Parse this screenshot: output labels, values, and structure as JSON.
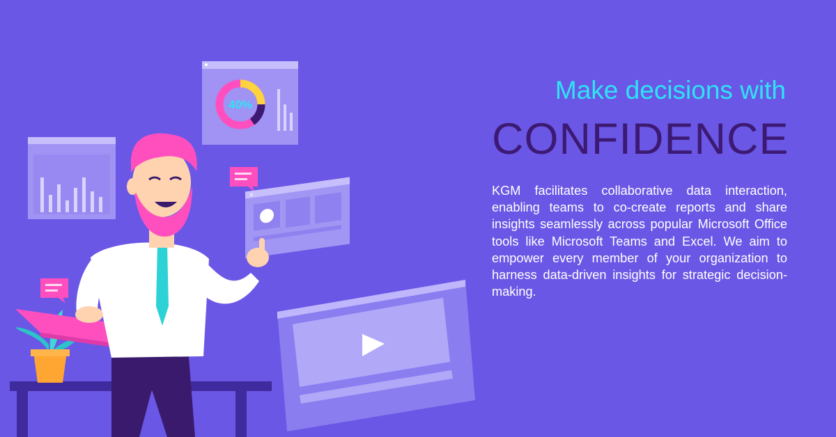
{
  "headline": {
    "line1": "Make decisions with",
    "line2": "CONFIDENCE"
  },
  "body": "KGM facilitates collaborative data interaction, enabling teams to co-create reports and share insights seamlessly across popular Microsoft Office tools like Microsoft Teams and Excel. We aim to empower every member of your orga­nization to harness data-driven insights for strategic decision-making.",
  "donut_widget": {
    "percent_label": "40%",
    "percent_value": 0.4
  },
  "colors": {
    "background": "#6b57e6",
    "headline_accent": "#2fe3f5",
    "headline_strong": "#3c1a73",
    "body_text": "#ffffff",
    "pink": "#ff4fbf",
    "yellow": "#ffd23f"
  }
}
